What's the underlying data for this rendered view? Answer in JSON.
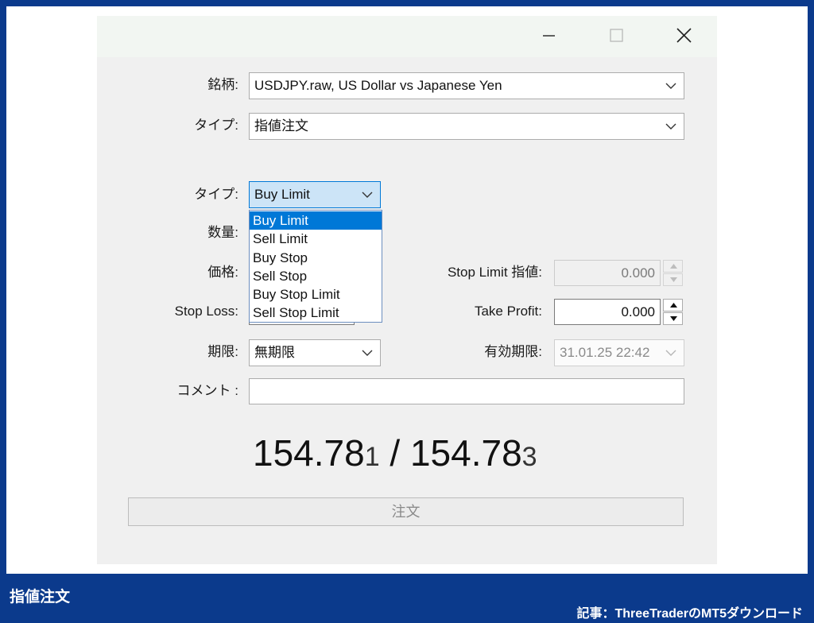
{
  "window": {
    "controls": [
      "minimize-icon",
      "maximize-icon",
      "close-icon"
    ]
  },
  "form": {
    "symbol": {
      "label": "銘柄:",
      "value": "USDJPY.raw, US Dollar vs Japanese Yen"
    },
    "type": {
      "label": "タイプ:",
      "value": "指値注文"
    },
    "order_type": {
      "label": "タイプ:",
      "value": "Buy Limit",
      "options": [
        "Buy Limit",
        "Sell Limit",
        "Buy Stop",
        "Sell Stop",
        "Buy Stop Limit",
        "Sell Stop Limit"
      ],
      "selected_index": 0
    },
    "volume": {
      "label": "数量:"
    },
    "price": {
      "label": "価格:"
    },
    "stop_limit": {
      "label": "Stop Limit 指値:",
      "value": "0.000",
      "disabled": true
    },
    "stop_loss": {
      "label": "Stop Loss:"
    },
    "take_profit": {
      "label": "Take Profit:",
      "value": "0.000"
    },
    "expiration": {
      "label": "期限:",
      "value": "無期限"
    },
    "expiration_date": {
      "label": "有効期限:",
      "value": "31.01.25 22:42",
      "disabled": true
    },
    "comment": {
      "label": "コメント :",
      "value": ""
    }
  },
  "quote": {
    "bid_main": "154.78",
    "bid_last": "1",
    "separator": " / ",
    "ask_main": "154.78",
    "ask_last": "3"
  },
  "order_button": {
    "label": "注文",
    "disabled": true
  },
  "footer": {
    "title": "指値注文",
    "link": "記事：ThreeTraderのMT5ダウンロード"
  },
  "colors": {
    "frame": "#0b3a8c",
    "dialog_bg": "#f0f0f0",
    "selection": "#0078d7",
    "focused_combo": "#cce4f7"
  }
}
